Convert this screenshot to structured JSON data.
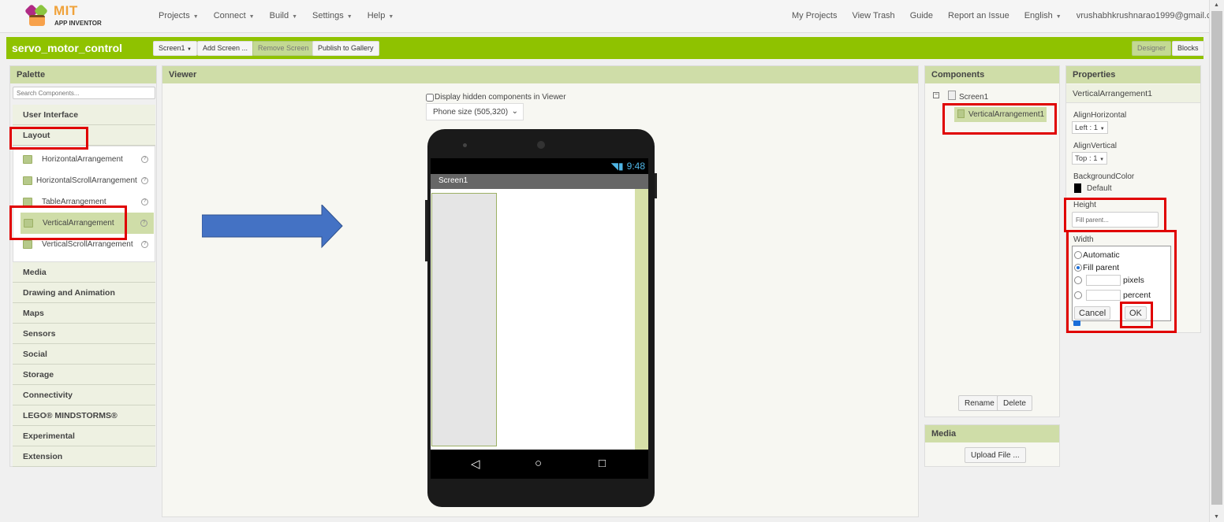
{
  "app": {
    "logo_mit": "MIT",
    "logo_sub": "APP INVENTOR"
  },
  "nav_left": [
    {
      "label": "Projects"
    },
    {
      "label": "Connect"
    },
    {
      "label": "Build"
    },
    {
      "label": "Settings"
    },
    {
      "label": "Help"
    }
  ],
  "nav_right": {
    "my_projects": "My Projects",
    "view_trash": "View Trash",
    "guide": "Guide",
    "report": "Report an Issue",
    "language": "English",
    "account": "vrushabhkrushnarao1999@gmail.com"
  },
  "projectbar": {
    "project_name": "servo_motor_control",
    "screen_select": "Screen1",
    "add_screen": "Add Screen ...",
    "remove_screen": "Remove Screen",
    "publish": "Publish to Gallery",
    "designer": "Designer",
    "blocks": "Blocks"
  },
  "palette": {
    "title": "Palette",
    "search_placeholder": "Search Components...",
    "categories_top": [
      "User Interface",
      "Layout"
    ],
    "layout_items": [
      {
        "label": "HorizontalArrangement",
        "selected": false
      },
      {
        "label": "HorizontalScrollArrangement",
        "selected": false
      },
      {
        "label": "TableArrangement",
        "selected": false
      },
      {
        "label": "VerticalArrangement",
        "selected": true
      },
      {
        "label": "VerticalScrollArrangement",
        "selected": false
      }
    ],
    "categories_bottom": [
      "Media",
      "Drawing and Animation",
      "Maps",
      "Sensors",
      "Social",
      "Storage",
      "Connectivity",
      "LEGO® MINDSTORMS®",
      "Experimental",
      "Extension"
    ]
  },
  "viewer": {
    "title": "Viewer",
    "hidden_checkbox_label": "Display hidden components in Viewer",
    "hidden_checked": false,
    "phone_size": "Phone size (505,320)",
    "status_time": "9:48",
    "screen_title": "Screen1"
  },
  "components": {
    "title": "Components",
    "tree_root": "Screen1",
    "tree_child": "VerticalArrangement1",
    "rename": "Rename",
    "delete": "Delete"
  },
  "media": {
    "title": "Media",
    "upload": "Upload File ..."
  },
  "properties": {
    "title": "Properties",
    "component": "VerticalArrangement1",
    "align_horizontal_label": "AlignHorizontal",
    "align_horizontal_value": "Left : 1",
    "align_vertical_label": "AlignVertical",
    "align_vertical_value": "Top : 1",
    "bg_color_label": "BackgroundColor",
    "bg_color_value": "Default",
    "bg_color_swatch": "#000000",
    "height_label": "Height",
    "height_value": "Fill parent...",
    "width_label": "Width",
    "width_options": {
      "automatic": "Automatic",
      "fill_parent": "Fill parent",
      "pixels": "pixels",
      "percent": "percent"
    },
    "width_selected": "fill_parent",
    "cancel": "Cancel",
    "ok": "OK"
  },
  "colors": {
    "brand_green": "#8fc200",
    "panel_header": "#cfdda8",
    "highlight_red": "#e00000",
    "arrow_blue": "#4472c4"
  }
}
